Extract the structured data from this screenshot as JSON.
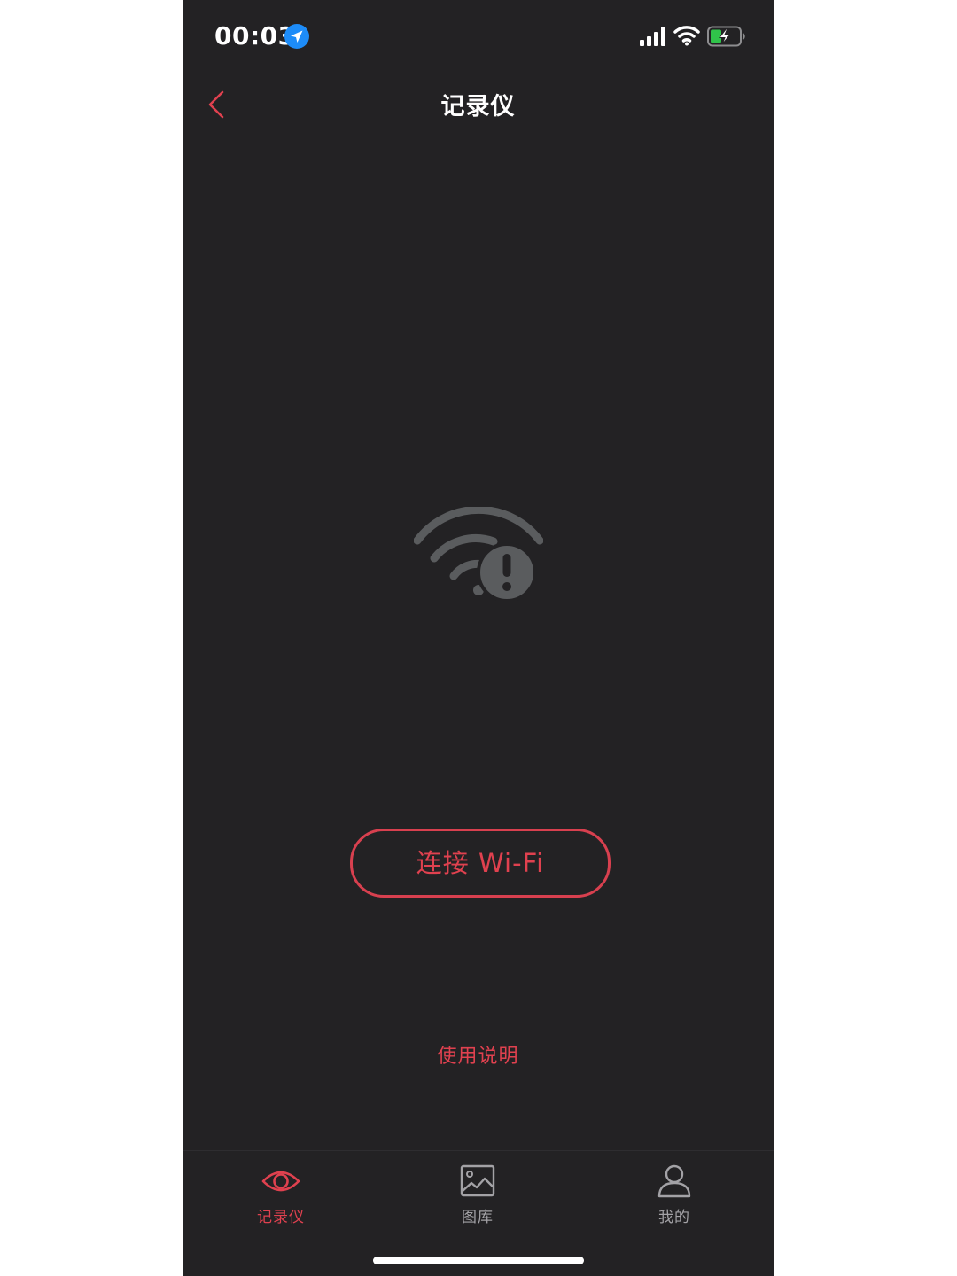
{
  "status_bar": {
    "time": "00:03",
    "location_icon": "location-arrow-icon",
    "signal_icon": "cellular-signal-icon",
    "wifi_icon": "wifi-icon",
    "battery_icon": "battery-charging-icon"
  },
  "nav": {
    "back_icon": "chevron-left-icon",
    "title": "记录仪"
  },
  "main": {
    "status_icon": "wifi-disconnected-warning-icon",
    "connect_button_label": "连接 Wi-Fi",
    "help_link": "使用说明"
  },
  "tab_bar": {
    "active_index": 0,
    "items": [
      {
        "label": "记录仪",
        "icon": "eye-icon"
      },
      {
        "label": "图库",
        "icon": "image-icon"
      },
      {
        "label": "我的",
        "icon": "person-icon"
      }
    ]
  },
  "colors": {
    "background": "#232224",
    "accent": "#e0414f",
    "inactive": "#a3a2a6",
    "icon_gray": "#5a5c5e",
    "battery_green": "#30c34a",
    "location_blue": "#1d8cf8"
  }
}
